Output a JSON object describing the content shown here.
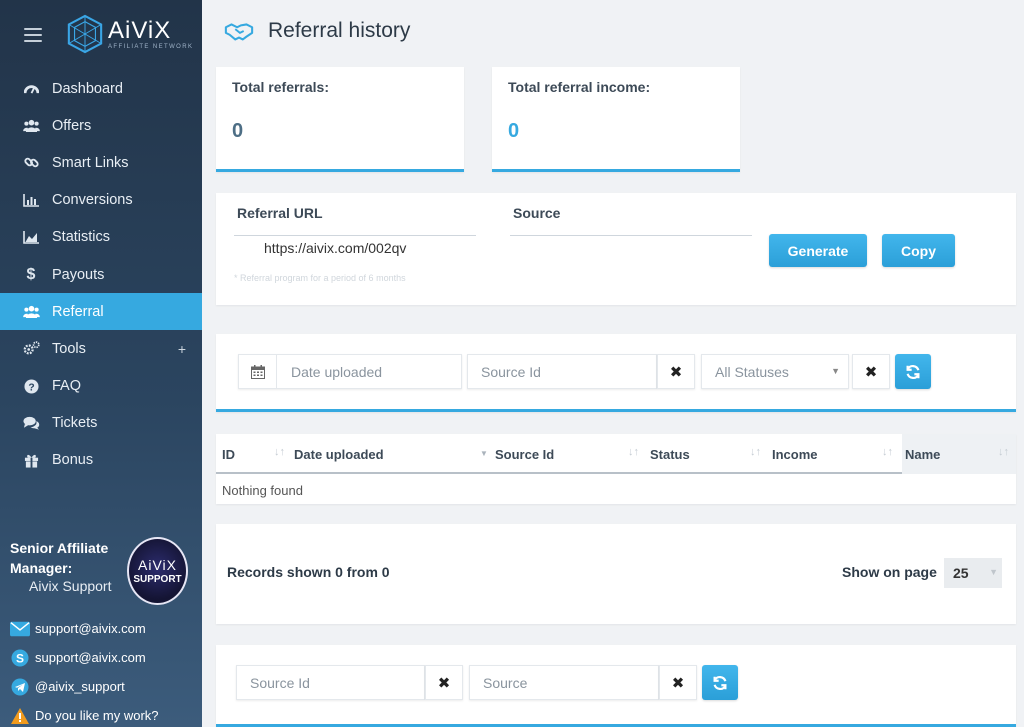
{
  "brand": {
    "name": "AiViX",
    "subtitle": "AFFILIATE NETWORK"
  },
  "sidebar": {
    "items": [
      {
        "label": "Dashboard",
        "icon": "dashboard-icon"
      },
      {
        "label": "Offers",
        "icon": "users-icon"
      },
      {
        "label": "Smart Links",
        "icon": "link-icon"
      },
      {
        "label": "Conversions",
        "icon": "bar-chart-icon"
      },
      {
        "label": "Statistics",
        "icon": "area-chart-icon"
      },
      {
        "label": "Payouts",
        "icon": "dollar-icon"
      },
      {
        "label": "Referral",
        "icon": "users-icon",
        "active": true
      },
      {
        "label": "Tools",
        "icon": "gears-icon",
        "expand": "+"
      },
      {
        "label": "FAQ",
        "icon": "question-icon"
      },
      {
        "label": "Tickets",
        "icon": "comments-icon"
      },
      {
        "label": "Bonus",
        "icon": "gift-icon"
      }
    ],
    "manager": {
      "label": "Senior Affiliate Manager:",
      "name": "Aivix Support",
      "badge_top": "AiViX",
      "badge_bottom": "SUPPORT"
    },
    "contacts": [
      {
        "icon": "email-icon",
        "text": "support@aivix.com"
      },
      {
        "icon": "skype-icon",
        "text": "support@aivix.com"
      },
      {
        "icon": "telegram-icon",
        "text": "@aivix_support"
      },
      {
        "icon": "warning-icon",
        "text": "Do you like my work?"
      }
    ]
  },
  "page": {
    "title": "Referral history"
  },
  "stats": {
    "total_referrals_label": "Total referrals:",
    "total_referrals_value": "0",
    "total_income_label": "Total referral income:",
    "total_income_value": "0"
  },
  "referral": {
    "url_label": "Referral URL",
    "url_value": "https://aivix.com/002qv",
    "source_label": "Source",
    "note": "* Referral program for a period of 6 months",
    "generate_label": "Generate",
    "copy_label": "Copy"
  },
  "filters": {
    "date_placeholder": "Date uploaded",
    "source_id_placeholder": "Source Id",
    "status_value": "All Statuses"
  },
  "table": {
    "columns": [
      "ID",
      "Date uploaded",
      "Source Id",
      "Status",
      "Income",
      "Name"
    ],
    "empty": "Nothing found"
  },
  "pager": {
    "records": "Records shown 0 from 0",
    "show_on_page_label": "Show on page",
    "page_size": "25"
  },
  "filters2": {
    "source_id_placeholder": "Source Id",
    "source_placeholder": "Source"
  },
  "colors": {
    "accent": "#36a9e0",
    "sidebar": "#2b4560"
  }
}
